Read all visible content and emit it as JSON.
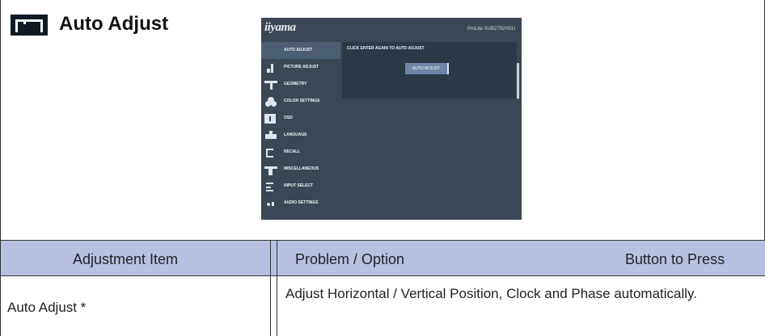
{
  "section": {
    "title": "Auto Adjust"
  },
  "osd": {
    "logo": "iiyama",
    "model": "ProLite XUB2792HSU",
    "menu_items": [
      {
        "label": "AUTO ADJUST",
        "icon": "auto-adjust-icon",
        "active": true
      },
      {
        "label": "PICTURE ADJUST",
        "icon": "picture-adjust-icon",
        "active": false
      },
      {
        "label": "GEOMETRY",
        "icon": "geometry-icon",
        "active": false
      },
      {
        "label": "COLOR SETTINGS",
        "icon": "color-settings-icon",
        "active": false
      },
      {
        "label": "OSD",
        "icon": "osd-icon",
        "active": false
      },
      {
        "label": "LANGUAGE",
        "icon": "language-icon",
        "active": false
      },
      {
        "label": "RECALL",
        "icon": "recall-icon",
        "active": false
      },
      {
        "label": "MISCELLANEOUS",
        "icon": "miscellaneous-icon",
        "active": false
      },
      {
        "label": "INPUT SELECT",
        "icon": "input-select-icon",
        "active": false
      },
      {
        "label": "AUDIO SETTINGS",
        "icon": "audio-settings-icon",
        "active": false
      }
    ],
    "prompt": "CLICK ENTER AGAIN TO AUTO ADJUST",
    "button_label": "AUTO ADJUST",
    "colors": {
      "background": "#3b4754",
      "panel": "#2c3a48",
      "button": "#6e85a5"
    }
  },
  "table": {
    "header": {
      "item": "Adjustment Item",
      "problem": "Problem / Option",
      "button": "Button to Press"
    },
    "rows": [
      {
        "item": "Auto Adjust *",
        "description": "Adjust Horizontal / Vertical  Position, Clock and Phase automatically."
      }
    ],
    "header_color": "#b8c0e2"
  }
}
